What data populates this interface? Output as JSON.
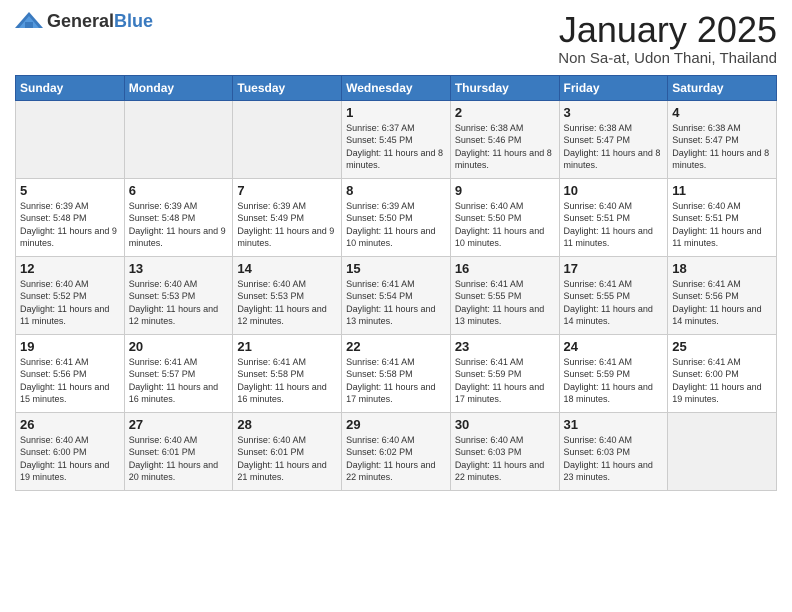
{
  "header": {
    "logo_general": "General",
    "logo_blue": "Blue",
    "title": "January 2025",
    "subtitle": "Non Sa-at, Udon Thani, Thailand"
  },
  "days_of_week": [
    "Sunday",
    "Monday",
    "Tuesday",
    "Wednesday",
    "Thursday",
    "Friday",
    "Saturday"
  ],
  "weeks": [
    [
      {
        "day": "",
        "sunrise": "",
        "sunset": "",
        "daylight": ""
      },
      {
        "day": "",
        "sunrise": "",
        "sunset": "",
        "daylight": ""
      },
      {
        "day": "",
        "sunrise": "",
        "sunset": "",
        "daylight": ""
      },
      {
        "day": "1",
        "sunrise": "Sunrise: 6:37 AM",
        "sunset": "Sunset: 5:45 PM",
        "daylight": "Daylight: 11 hours and 8 minutes."
      },
      {
        "day": "2",
        "sunrise": "Sunrise: 6:38 AM",
        "sunset": "Sunset: 5:46 PM",
        "daylight": "Daylight: 11 hours and 8 minutes."
      },
      {
        "day": "3",
        "sunrise": "Sunrise: 6:38 AM",
        "sunset": "Sunset: 5:47 PM",
        "daylight": "Daylight: 11 hours and 8 minutes."
      },
      {
        "day": "4",
        "sunrise": "Sunrise: 6:38 AM",
        "sunset": "Sunset: 5:47 PM",
        "daylight": "Daylight: 11 hours and 8 minutes."
      }
    ],
    [
      {
        "day": "5",
        "sunrise": "Sunrise: 6:39 AM",
        "sunset": "Sunset: 5:48 PM",
        "daylight": "Daylight: 11 hours and 9 minutes."
      },
      {
        "day": "6",
        "sunrise": "Sunrise: 6:39 AM",
        "sunset": "Sunset: 5:48 PM",
        "daylight": "Daylight: 11 hours and 9 minutes."
      },
      {
        "day": "7",
        "sunrise": "Sunrise: 6:39 AM",
        "sunset": "Sunset: 5:49 PM",
        "daylight": "Daylight: 11 hours and 9 minutes."
      },
      {
        "day": "8",
        "sunrise": "Sunrise: 6:39 AM",
        "sunset": "Sunset: 5:50 PM",
        "daylight": "Daylight: 11 hours and 10 minutes."
      },
      {
        "day": "9",
        "sunrise": "Sunrise: 6:40 AM",
        "sunset": "Sunset: 5:50 PM",
        "daylight": "Daylight: 11 hours and 10 minutes."
      },
      {
        "day": "10",
        "sunrise": "Sunrise: 6:40 AM",
        "sunset": "Sunset: 5:51 PM",
        "daylight": "Daylight: 11 hours and 11 minutes."
      },
      {
        "day": "11",
        "sunrise": "Sunrise: 6:40 AM",
        "sunset": "Sunset: 5:51 PM",
        "daylight": "Daylight: 11 hours and 11 minutes."
      }
    ],
    [
      {
        "day": "12",
        "sunrise": "Sunrise: 6:40 AM",
        "sunset": "Sunset: 5:52 PM",
        "daylight": "Daylight: 11 hours and 11 minutes."
      },
      {
        "day": "13",
        "sunrise": "Sunrise: 6:40 AM",
        "sunset": "Sunset: 5:53 PM",
        "daylight": "Daylight: 11 hours and 12 minutes."
      },
      {
        "day": "14",
        "sunrise": "Sunrise: 6:40 AM",
        "sunset": "Sunset: 5:53 PM",
        "daylight": "Daylight: 11 hours and 12 minutes."
      },
      {
        "day": "15",
        "sunrise": "Sunrise: 6:41 AM",
        "sunset": "Sunset: 5:54 PM",
        "daylight": "Daylight: 11 hours and 13 minutes."
      },
      {
        "day": "16",
        "sunrise": "Sunrise: 6:41 AM",
        "sunset": "Sunset: 5:55 PM",
        "daylight": "Daylight: 11 hours and 13 minutes."
      },
      {
        "day": "17",
        "sunrise": "Sunrise: 6:41 AM",
        "sunset": "Sunset: 5:55 PM",
        "daylight": "Daylight: 11 hours and 14 minutes."
      },
      {
        "day": "18",
        "sunrise": "Sunrise: 6:41 AM",
        "sunset": "Sunset: 5:56 PM",
        "daylight": "Daylight: 11 hours and 14 minutes."
      }
    ],
    [
      {
        "day": "19",
        "sunrise": "Sunrise: 6:41 AM",
        "sunset": "Sunset: 5:56 PM",
        "daylight": "Daylight: 11 hours and 15 minutes."
      },
      {
        "day": "20",
        "sunrise": "Sunrise: 6:41 AM",
        "sunset": "Sunset: 5:57 PM",
        "daylight": "Daylight: 11 hours and 16 minutes."
      },
      {
        "day": "21",
        "sunrise": "Sunrise: 6:41 AM",
        "sunset": "Sunset: 5:58 PM",
        "daylight": "Daylight: 11 hours and 16 minutes."
      },
      {
        "day": "22",
        "sunrise": "Sunrise: 6:41 AM",
        "sunset": "Sunset: 5:58 PM",
        "daylight": "Daylight: 11 hours and 17 minutes."
      },
      {
        "day": "23",
        "sunrise": "Sunrise: 6:41 AM",
        "sunset": "Sunset: 5:59 PM",
        "daylight": "Daylight: 11 hours and 17 minutes."
      },
      {
        "day": "24",
        "sunrise": "Sunrise: 6:41 AM",
        "sunset": "Sunset: 5:59 PM",
        "daylight": "Daylight: 11 hours and 18 minutes."
      },
      {
        "day": "25",
        "sunrise": "Sunrise: 6:41 AM",
        "sunset": "Sunset: 6:00 PM",
        "daylight": "Daylight: 11 hours and 19 minutes."
      }
    ],
    [
      {
        "day": "26",
        "sunrise": "Sunrise: 6:40 AM",
        "sunset": "Sunset: 6:00 PM",
        "daylight": "Daylight: 11 hours and 19 minutes."
      },
      {
        "day": "27",
        "sunrise": "Sunrise: 6:40 AM",
        "sunset": "Sunset: 6:01 PM",
        "daylight": "Daylight: 11 hours and 20 minutes."
      },
      {
        "day": "28",
        "sunrise": "Sunrise: 6:40 AM",
        "sunset": "Sunset: 6:01 PM",
        "daylight": "Daylight: 11 hours and 21 minutes."
      },
      {
        "day": "29",
        "sunrise": "Sunrise: 6:40 AM",
        "sunset": "Sunset: 6:02 PM",
        "daylight": "Daylight: 11 hours and 22 minutes."
      },
      {
        "day": "30",
        "sunrise": "Sunrise: 6:40 AM",
        "sunset": "Sunset: 6:03 PM",
        "daylight": "Daylight: 11 hours and 22 minutes."
      },
      {
        "day": "31",
        "sunrise": "Sunrise: 6:40 AM",
        "sunset": "Sunset: 6:03 PM",
        "daylight": "Daylight: 11 hours and 23 minutes."
      },
      {
        "day": "",
        "sunrise": "",
        "sunset": "",
        "daylight": ""
      }
    ]
  ]
}
